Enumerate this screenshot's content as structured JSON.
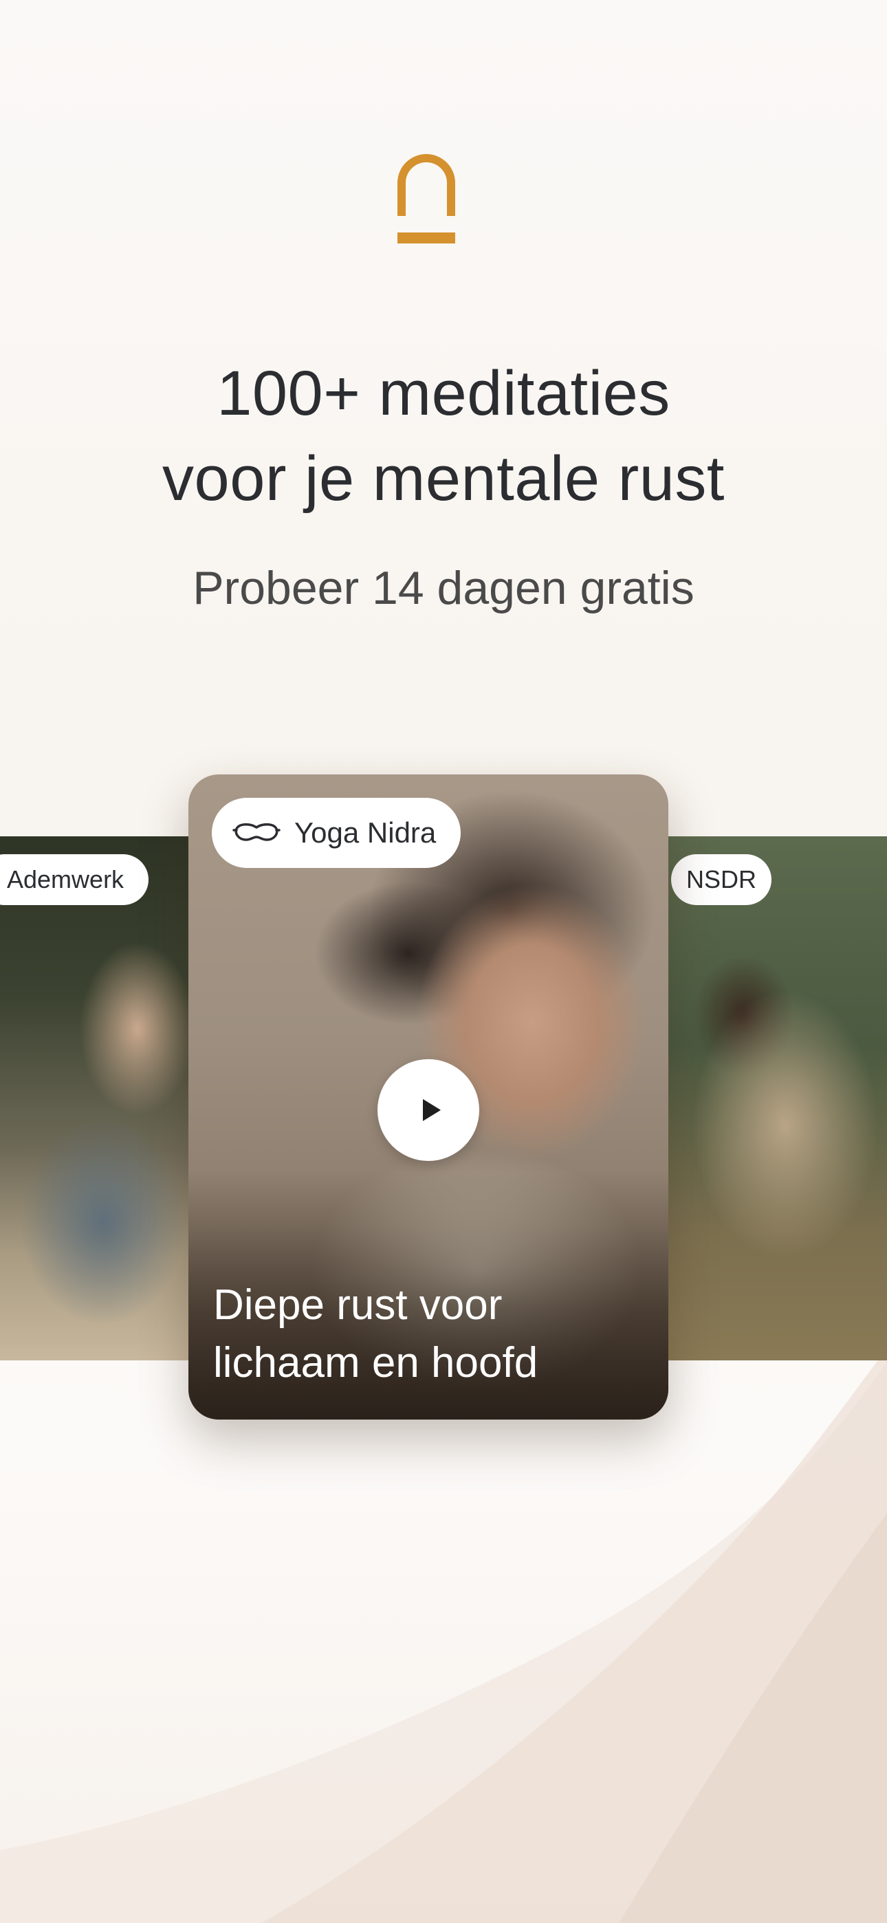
{
  "app": {
    "logo_icon": "arch-logo-icon",
    "accent_color": "#d4912e"
  },
  "hero": {
    "headline_line1": "100+ meditaties",
    "headline_line2": "voor je mentale rust",
    "subheadline": "Probeer 14 dagen gratis"
  },
  "carousel": {
    "left_card": {
      "category": "Ademwerk"
    },
    "main_card": {
      "category": "Yoga Nidra",
      "category_icon": "sleep-mask-icon",
      "title_line1": "Diepe rust voor",
      "title_line2": "lichaam en hoofd",
      "play_icon": "play-icon"
    },
    "right_card": {
      "category": "NSDR"
    }
  }
}
